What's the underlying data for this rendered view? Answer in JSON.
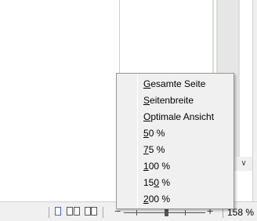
{
  "zoom_menu": {
    "items": [
      {
        "accel": "G",
        "rest": "esamte Seite"
      },
      {
        "accel": "S",
        "rest": "eitenbreite"
      },
      {
        "accel": "O",
        "rest": "ptimale Ansicht"
      },
      {
        "accel": "5",
        "rest": "0 %"
      },
      {
        "accel": "7",
        "rest": "5 %"
      },
      {
        "accel": "1",
        "rest": "00 %"
      },
      {
        "accel": "",
        "pre": "15",
        "acc2": "0",
        "rest": " %"
      },
      {
        "accel": "2",
        "rest": "00 %"
      }
    ]
  },
  "statusbar": {
    "view_icons": [
      "single-page-view-icon",
      "two-page-view-icon",
      "book-view-icon"
    ],
    "zoom_minus": "−",
    "zoom_plus": "+",
    "zoom_level": "158 %"
  },
  "colors": {
    "menu_bg": "#f0f0f0",
    "statusbar_bg": "#f0f0f0",
    "page_border": "#d8d89a"
  }
}
